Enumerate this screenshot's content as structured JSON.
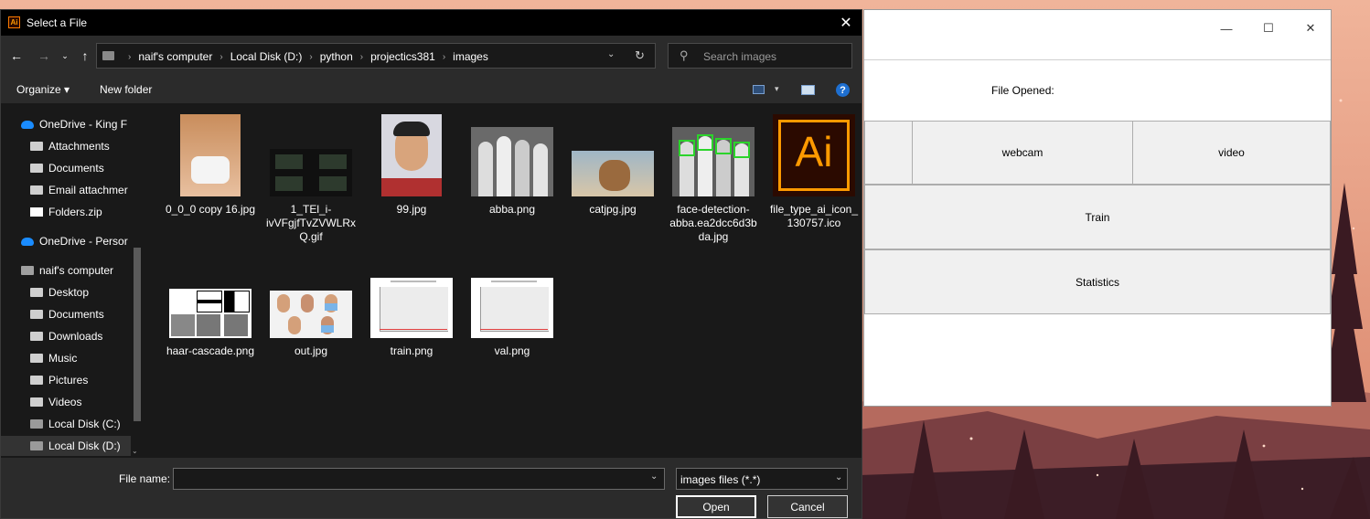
{
  "dialog": {
    "title": "Select a File",
    "app_icon": "Ai",
    "close_glyph": "✕",
    "nav": {
      "back_glyph": "←",
      "forward_glyph": "→",
      "recent_glyph": "⌄",
      "up_glyph": "↑",
      "breadcrumbs": [
        "naif's computer",
        "Local Disk (D:)",
        "python",
        "projectics381",
        "images"
      ],
      "crumb_separator": "›",
      "refresh_glyph": "↻",
      "dropdown_glyph": "⌄"
    },
    "search": {
      "placeholder": "Search images",
      "icon_glyph": "⚲"
    },
    "toolbar": {
      "organize": "Organize ▾",
      "new_folder": "New folder",
      "view_dropdown": "▾",
      "help_glyph": "?"
    },
    "tree": [
      {
        "label": "OneDrive - King F",
        "icon": "cloud"
      },
      {
        "label": "Attachments",
        "icon": "folder"
      },
      {
        "label": "Documents",
        "icon": "folder"
      },
      {
        "label": "Email attachmer",
        "icon": "folder"
      },
      {
        "label": "Folders.zip",
        "icon": "zip"
      },
      {
        "label": "OneDrive - Persor",
        "icon": "cloud"
      },
      {
        "label": "naif's computer",
        "icon": "pc"
      },
      {
        "label": "Desktop",
        "icon": "folder"
      },
      {
        "label": "Documents",
        "icon": "folder"
      },
      {
        "label": "Downloads",
        "icon": "folder"
      },
      {
        "label": "Music",
        "icon": "folder"
      },
      {
        "label": "Pictures",
        "icon": "folder"
      },
      {
        "label": "Videos",
        "icon": "folder"
      },
      {
        "label": "Local Disk (C:)",
        "icon": "drive"
      },
      {
        "label": "Local Disk (D:)",
        "icon": "drive",
        "selected": true
      }
    ],
    "files": [
      {
        "name": "0_0_0 copy 16.jpg",
        "thumb": "portrait-mask"
      },
      {
        "name": "1_TEl_i-ivVFgjfTvZVWLRxQ.gif",
        "thumb": "dark-grid"
      },
      {
        "name": "99.jpg",
        "thumb": "portrait-man"
      },
      {
        "name": "abba.png",
        "thumb": "group-photo"
      },
      {
        "name": "catjpg.jpg",
        "thumb": "cat"
      },
      {
        "name": "face-detection-abba.ea2dcc6d3bda.jpg",
        "thumb": "group-detect"
      },
      {
        "name": "file_type_ai_icon_130757.ico",
        "thumb": "ai-icon"
      },
      {
        "name": "haar-cascade.png",
        "thumb": "haar"
      },
      {
        "name": "out.jpg",
        "thumb": "faces-grid"
      },
      {
        "name": "train.png",
        "thumb": "plot"
      },
      {
        "name": "val.png",
        "thumb": "plot"
      }
    ],
    "bottom": {
      "filename_label": "File name:",
      "filename_value": "",
      "filetype_value": "images files (*.*)",
      "dropdown_glyph": "⌄",
      "open_label": "Open",
      "cancel_label": "Cancel"
    }
  },
  "app": {
    "window_controls": {
      "minimize": "—",
      "maximize": "☐",
      "close": "✕"
    },
    "file_opened_label": "File Opened:",
    "buttons": {
      "webcam": "webcam",
      "video": "video",
      "train": "Train",
      "statistics": "Statistics"
    }
  },
  "colors": {
    "dialog_bg": "#202020",
    "pane_bg": "#191919",
    "accent_blue": "#1a8cff",
    "app_button_bg": "#f0f0f0",
    "wallpaper_sky": "#e8a58a"
  }
}
